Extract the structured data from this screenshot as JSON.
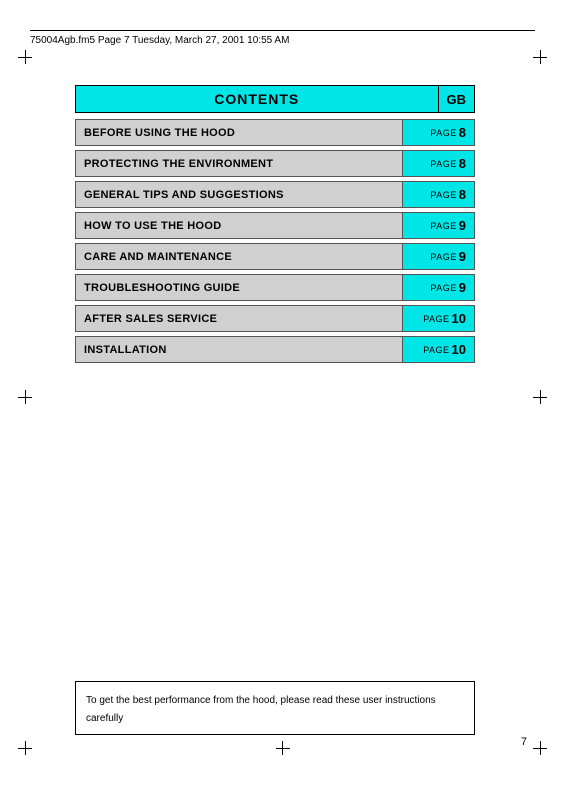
{
  "header": {
    "text": "75004Agb.fm5  Page 7  Tuesday, March 27, 2001  10:55 AM"
  },
  "contents": {
    "title": "CONTENTS",
    "gb_label": "GB"
  },
  "toc_items": [
    {
      "title": "BEFORE USING THE HOOD",
      "page_label": "PAGE",
      "page_num": "8"
    },
    {
      "title": "PROTECTING THE ENVIRONMENT",
      "page_label": "PAGE",
      "page_num": "8"
    },
    {
      "title": "GENERAL TIPS AND SUGGESTIONS",
      "page_label": "PAGE",
      "page_num": "8"
    },
    {
      "title": "HOW TO USE THE HOOD",
      "page_label": "PAGE",
      "page_num": "9"
    },
    {
      "title": "CARE AND MAINTENANCE",
      "page_label": "PAGE",
      "page_num": "9"
    },
    {
      "title": "TROUBLESHOOTING GUIDE",
      "page_label": "PAGE",
      "page_num": "9"
    },
    {
      "title": "AFTER SALES SERVICE",
      "page_label": "PAGE",
      "page_num": "10"
    },
    {
      "title": "INSTALLATION",
      "page_label": "PAGE",
      "page_num": "10"
    }
  ],
  "footer": {
    "note": "To get the best performance from the hood, please read these user instructions carefully"
  },
  "page_number": "7"
}
